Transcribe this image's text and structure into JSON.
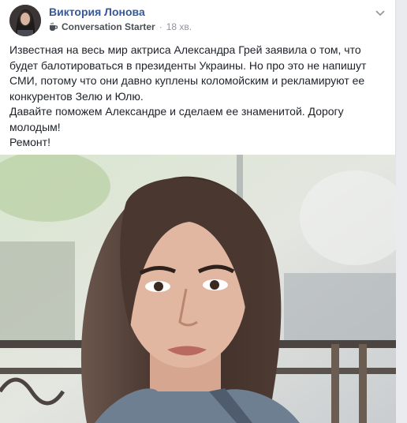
{
  "post": {
    "author": "Виктория Лонова",
    "badge": "Conversation Starter",
    "time_sep": "·",
    "time": "18 хв.",
    "paragraphs": [
      "Известная на весь мир актриса Александра Грей заявила о том, что будет балотироваться в президенты Украины. Но про это не напишут СМИ, потому что они давно куплены коломойским и рекламируют ее конкурентов Зелю и Юлю.",
      "Давайте поможем Александре и сделаем ее знаменитой. Дорогу молодым!",
      "Ремонт!"
    ]
  },
  "icons": {
    "badge": "coffee-cup-icon",
    "menu": "chevron-down-icon"
  },
  "colors": {
    "author": "#365899",
    "text": "#1d2129",
    "meta": "#90949c"
  }
}
